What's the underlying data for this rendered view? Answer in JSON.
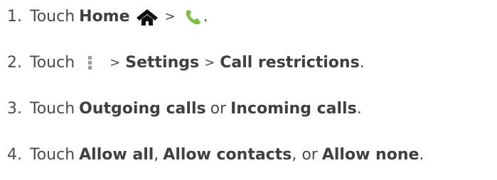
{
  "steps": [
    {
      "number": "1.",
      "touch": "Touch",
      "home": "Home",
      "separator": ">",
      "period": ".",
      "icons": [
        "home-icon",
        "phone-icon"
      ]
    },
    {
      "number": "2.",
      "touch": "Touch",
      "separator_1": ">",
      "settings": "Settings",
      "separator_2": ">",
      "call_restrictions": "Call restrictions",
      "period": ".",
      "icons": [
        "menu-icon"
      ]
    },
    {
      "number": "3.",
      "touch": "Touch",
      "outgoing_calls": "Outgoing calls",
      "or": "or",
      "incoming_calls": "Incoming calls",
      "period": "."
    },
    {
      "number": "4.",
      "touch": "Touch",
      "allow_all": "Allow all",
      "comma_1": ",",
      "allow_contacts": "Allow contacts",
      "comma_or": ", or",
      "allow_none": "Allow none",
      "period": "."
    }
  ],
  "colors": {
    "text": "#4a4a4a",
    "bold_text": "#3f3f3f",
    "home_icon": "#111111",
    "phone_icon": "#7bc043",
    "menu_icon": "#9a9a9a"
  }
}
